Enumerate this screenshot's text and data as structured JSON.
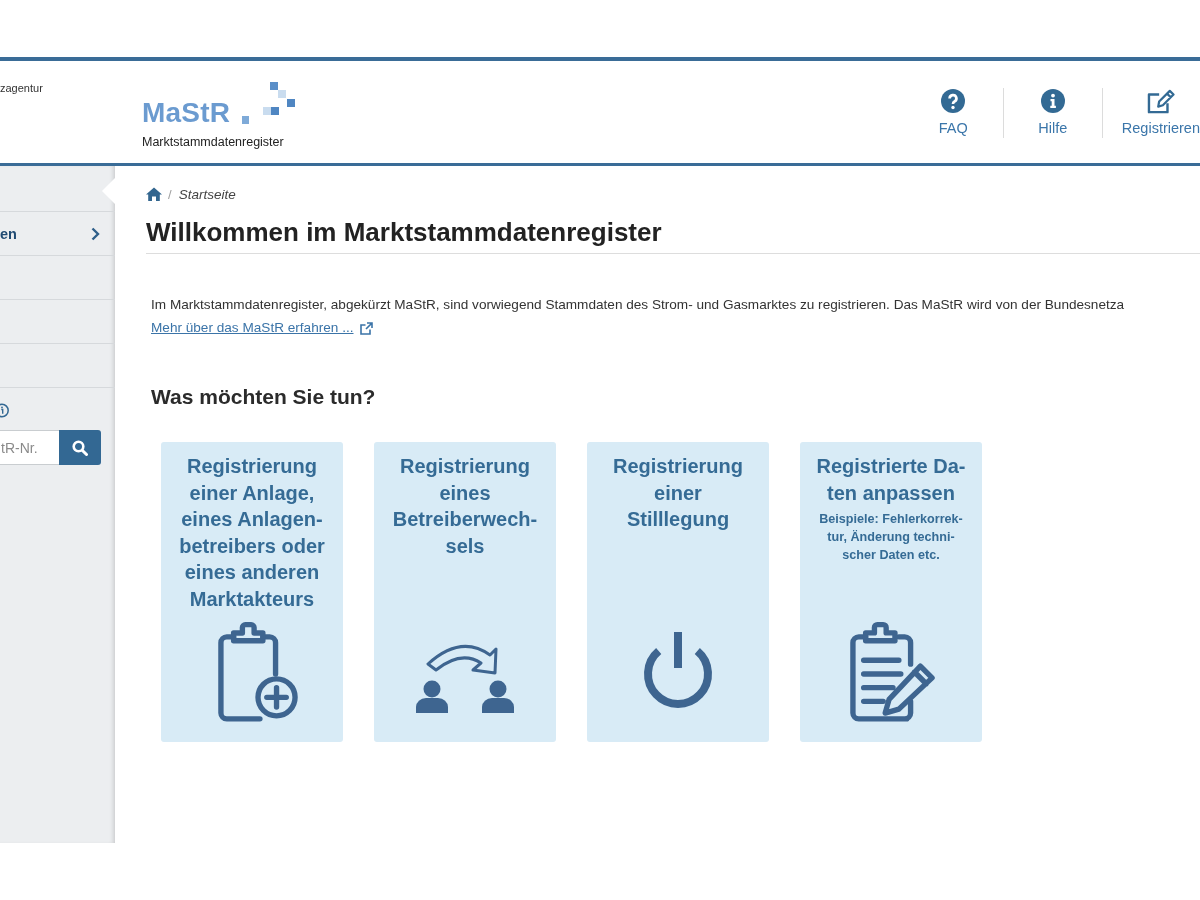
{
  "header": {
    "agency_text": "zagentur",
    "logo": {
      "name": "MaStR",
      "subtitle": "Marktstammdatenregister"
    },
    "nav": [
      {
        "kind": "faq",
        "label": "FAQ"
      },
      {
        "kind": "help",
        "label": "Hilfe"
      },
      {
        "kind": "register",
        "label": "Registrieren"
      }
    ]
  },
  "sidebar": {
    "items": [
      {
        "label": "en"
      }
    ],
    "search": {
      "placeholder": "tR-Nr."
    }
  },
  "breadcrumb": {
    "separator": "/",
    "items": [
      "Startseite"
    ]
  },
  "title": "Willkommen im Marktstammdatenregister",
  "intro": {
    "text": "Im Marktstammdatenregister, abgekürzt MaStR, sind vorwiegend Stammdaten des Strom- und Gasmarktes zu registrieren. Das MaStR wird von der Bundesnetza",
    "link": "Mehr über das MaStR erfahren ..."
  },
  "section_heading": "Was möchten Sie tun?",
  "actions": [
    {
      "kind": "register-new",
      "title": "Registrierung\neiner Anlage,\neines Anlagen-\nbetreibers oder\neines anderen\nMarktakteurs"
    },
    {
      "kind": "operator-change",
      "title": "Registrierung\neines\nBetreiberwech-\nsels"
    },
    {
      "kind": "decommission",
      "title": "Registrierung\neiner\nStilllegung"
    },
    {
      "kind": "edit-data",
      "title": "Registrierte Da-\nten anpassen",
      "note": "Beispiele: Fehlerkorrek-\ntur, Änderung techni-\nscher Daten etc."
    }
  ]
}
